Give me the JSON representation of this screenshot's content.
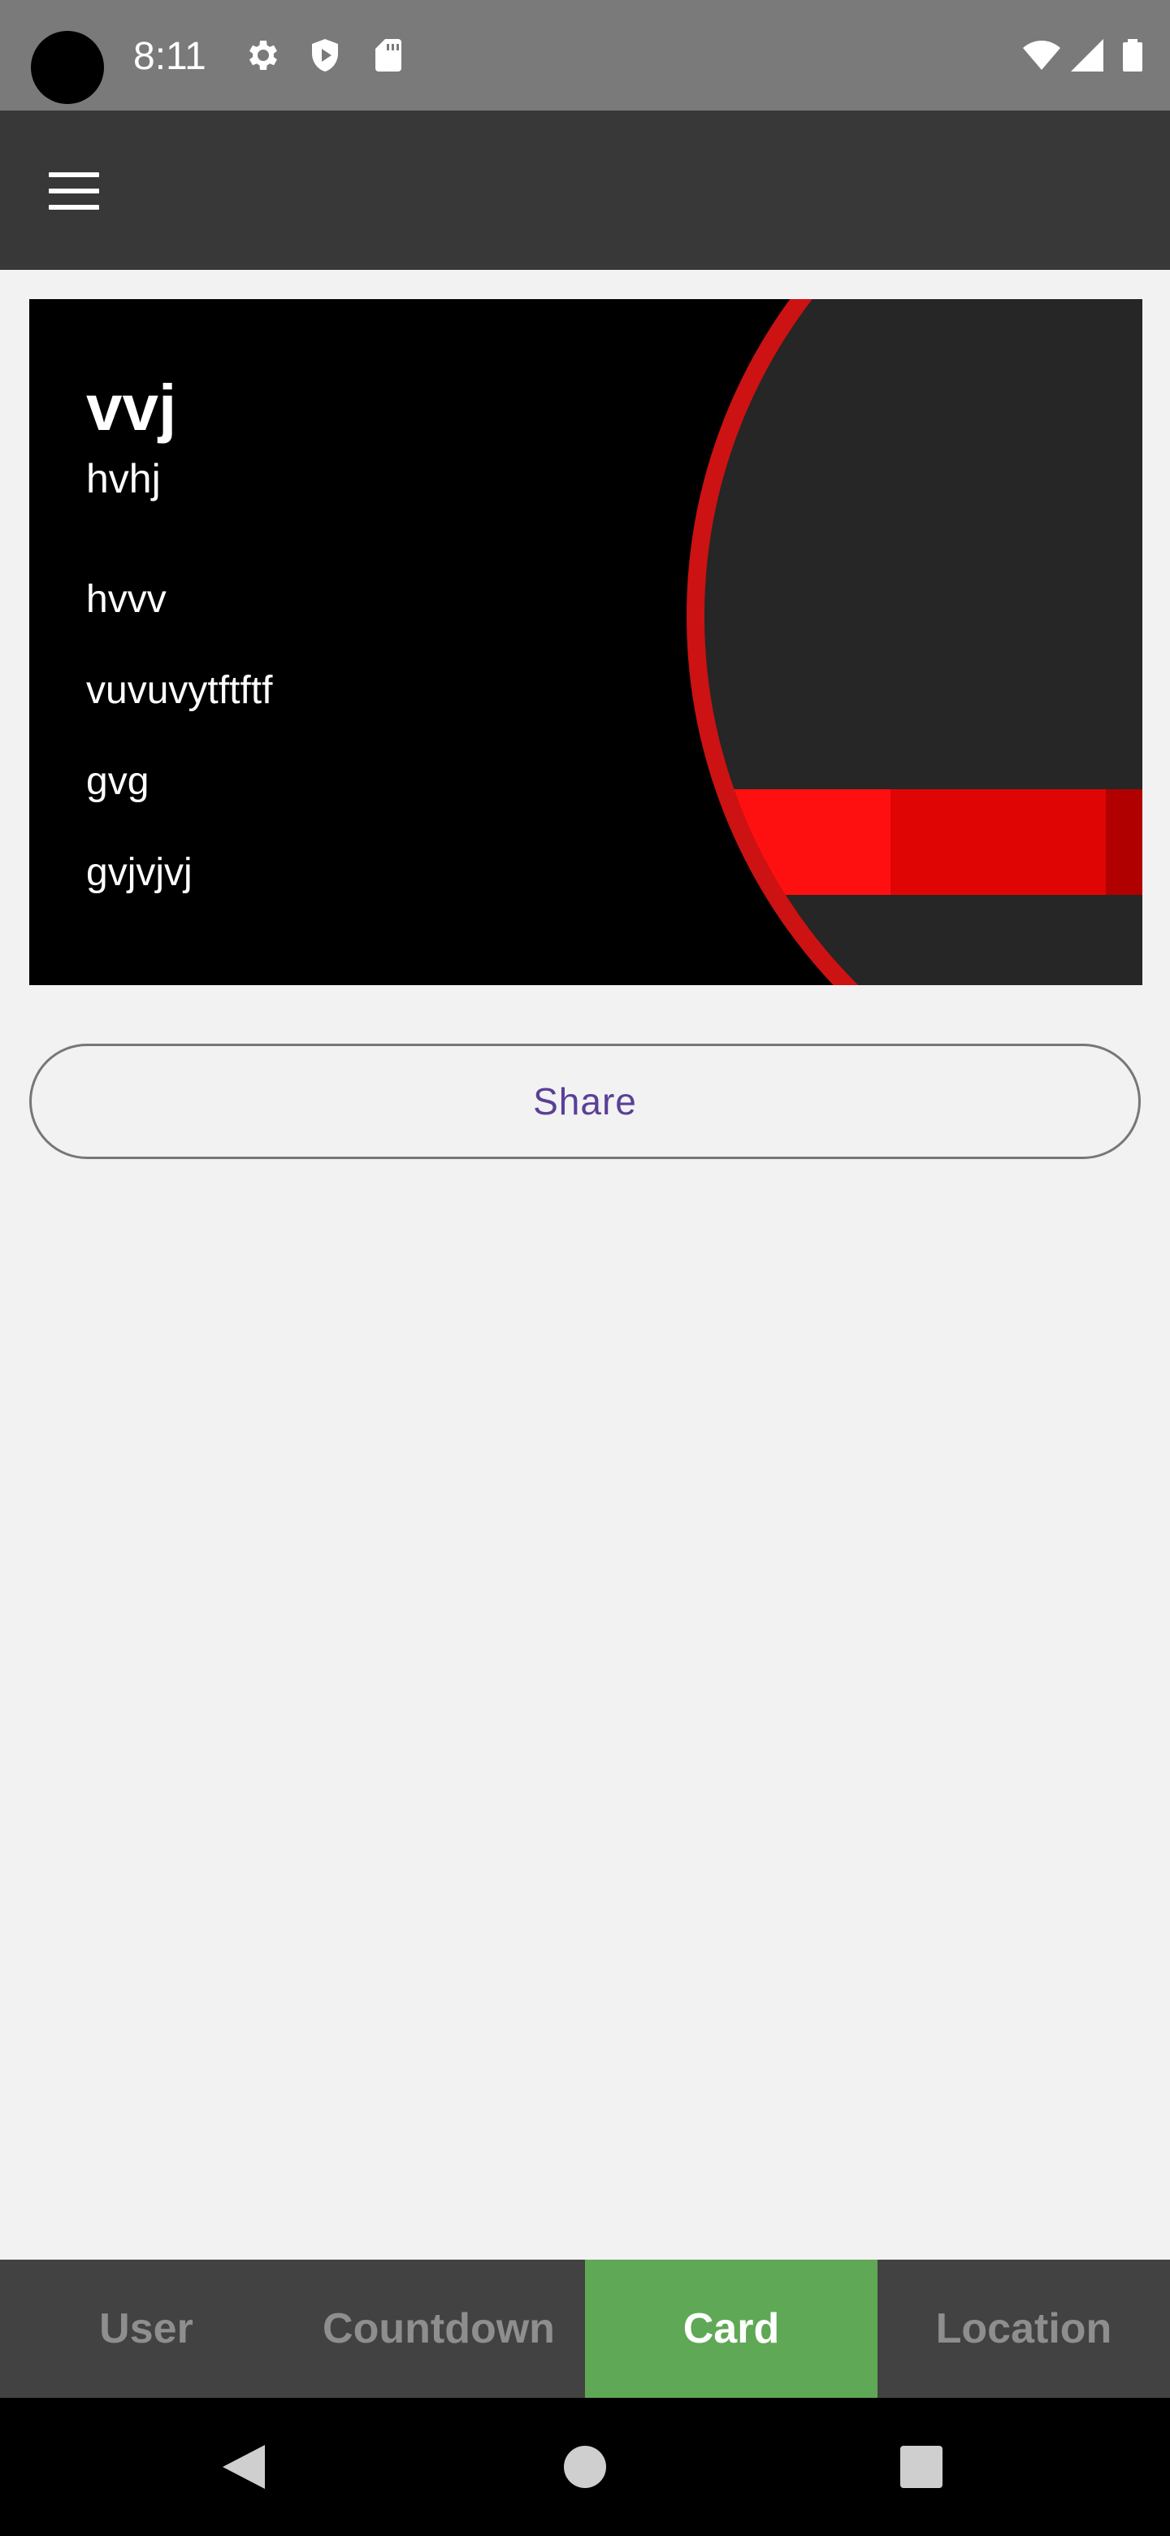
{
  "status_bar": {
    "time": "8:11",
    "icons": [
      "settings-icon",
      "shield-play-icon",
      "sd-card-icon",
      "wifi-icon",
      "signal-icon",
      "battery-icon"
    ]
  },
  "app_bar": {
    "menu_icon": "hamburger-menu-icon"
  },
  "card": {
    "title": "vvj",
    "subtitle": "hvhj",
    "lines": [
      "hvvv",
      "vuvuvytftftf",
      "gvg",
      "gvjvjvj"
    ],
    "accent_color": "#d01010"
  },
  "share": {
    "label": "Share"
  },
  "tabs": [
    {
      "label": "User",
      "active": false
    },
    {
      "label": "Countdown",
      "active": false
    },
    {
      "label": "Card",
      "active": true
    },
    {
      "label": "Location",
      "active": false
    }
  ],
  "nav_bar": {
    "icons": [
      "back-icon",
      "home-icon",
      "recents-icon"
    ]
  },
  "colors": {
    "status_bar": "#7a7a7a",
    "app_bar": "#383838",
    "tab_active": "#5fa855",
    "tab_bar": "#424242",
    "share_text": "#5a3f96"
  }
}
